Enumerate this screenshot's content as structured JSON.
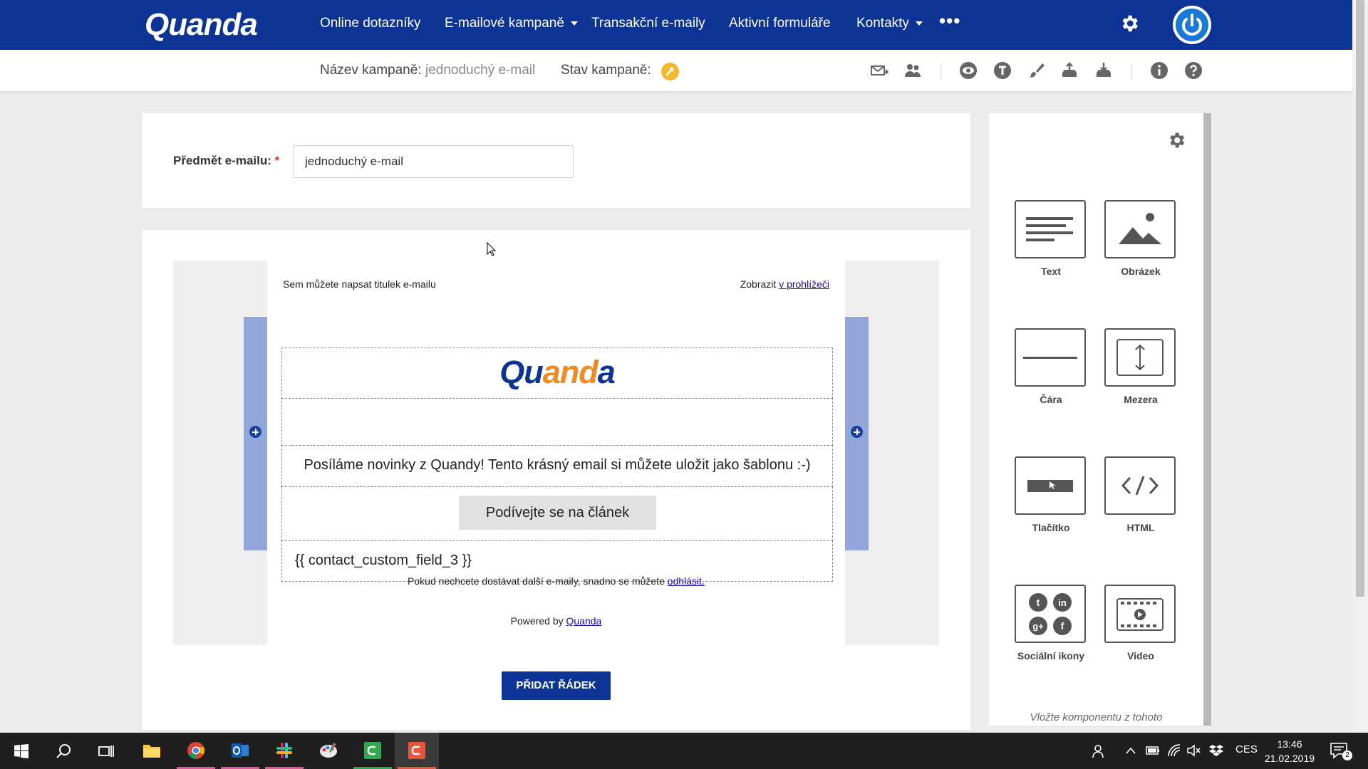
{
  "brand": "Quanda",
  "nav": {
    "items": [
      {
        "label": "Online dotazníky",
        "caret": false
      },
      {
        "label": "E-mailové kampaně",
        "caret": true
      },
      {
        "label": "Transakční e-maily",
        "caret": false
      },
      {
        "label": "Aktivní formuláře",
        "caret": false
      },
      {
        "label": "Kontakty",
        "caret": true
      }
    ],
    "more": "•••"
  },
  "subbar": {
    "name_label": "Název kampaně:",
    "name_value": "jednoduchý e-mail",
    "status_label": "Stav kampaně:"
  },
  "subject": {
    "label": "Předmět e-mailu:",
    "required_mark": "*",
    "value": "jednoduchý e-mail"
  },
  "email": {
    "header_text": "Sem můžete napsat titulek e-mailu",
    "browser_prefix": "Zobrazit",
    "browser_link": "v prohlížeči",
    "logo_main": "Qu",
    "logo_accent": "and",
    "logo_end": "a",
    "body_text": "Posíláme novinky z Quandy! Tento krásný email si můžete uložit jako šablonu :-)",
    "button_label": "Podívejte se na článek",
    "variable": "{{ contact_custom_field_3 }}",
    "unsub_text": "Pokud nechcete dostávat další e-maily, snadno se můžete",
    "unsub_link": "odhlásit.",
    "powered_prefix": "Powered by",
    "powered_link": "Quanda"
  },
  "add_row_label": "PŘIDAT ŘÁDEK",
  "components": [
    {
      "label": "Text",
      "icon": "text-icon"
    },
    {
      "label": "Obrázek",
      "icon": "image-icon"
    },
    {
      "label": "Čára",
      "icon": "line-icon"
    },
    {
      "label": "Mezera",
      "icon": "spacer-icon"
    },
    {
      "label": "Tlačítko",
      "icon": "button-icon"
    },
    {
      "label": "HTML",
      "icon": "code-icon"
    },
    {
      "label": "Sociální ikony",
      "icon": "social-icons-icon"
    },
    {
      "label": "Video",
      "icon": "video-icon"
    }
  ],
  "panel_hint": "Vložte komponentu z tohoto",
  "taskbar": {
    "lang": "CES",
    "time": "13:46",
    "date": "21.02.2019",
    "notifications": "2"
  },
  "colors": {
    "brand_blue": "#0d3394",
    "handle_blue": "#93a6d9",
    "status_yellow": "#f3b82c",
    "accent_orange": "#f08a24"
  }
}
